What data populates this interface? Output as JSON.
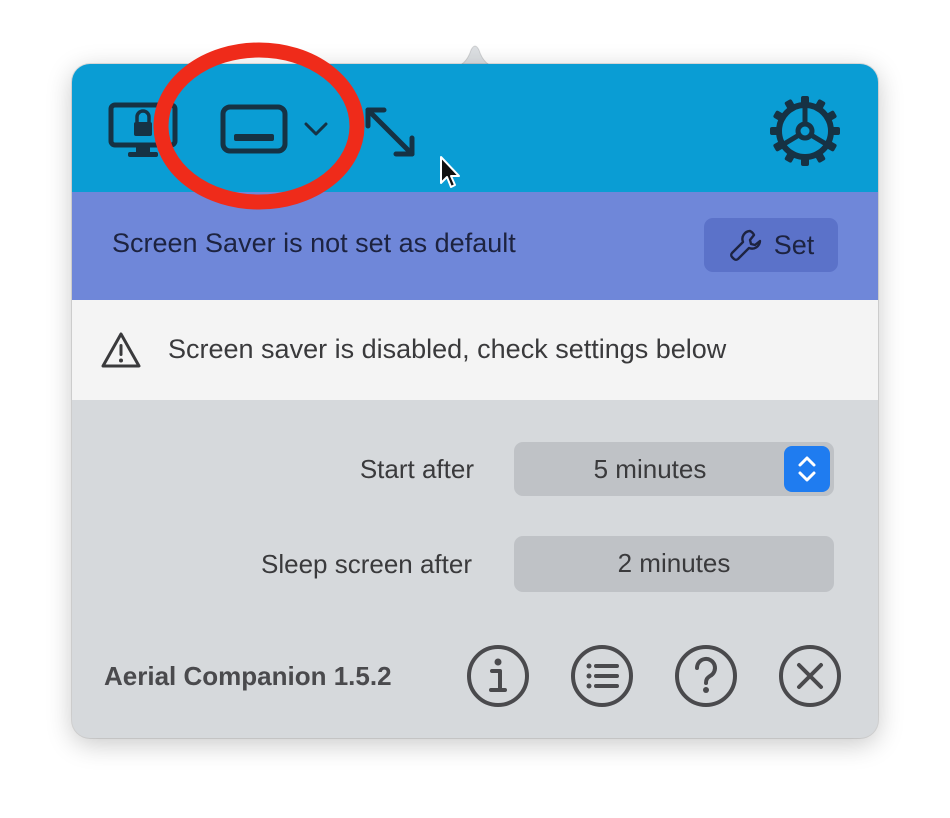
{
  "toolbar": {
    "lock_screen_icon": "monitor-lock-icon",
    "display_mode_icon": "display-window-icon",
    "display_mode_chevron": "chevron-down-icon",
    "expand_icon": "expand-diagonal-icon",
    "settings_icon": "gear-icon"
  },
  "banner": {
    "message": "Screen Saver is not set as default",
    "set_label": "Set",
    "set_icon": "wrench-icon"
  },
  "warning": {
    "icon": "warning-triangle-icon",
    "message": "Screen saver is disabled, check settings below"
  },
  "settings": {
    "start_after_label": "Start after",
    "start_after_value": "5 minutes",
    "sleep_after_label": "Sleep screen after",
    "sleep_after_value": "2 minutes"
  },
  "footer": {
    "version": "Aerial Companion 1.5.2",
    "buttons": [
      "info-icon",
      "list-icon",
      "help-icon",
      "close-icon"
    ]
  },
  "colors": {
    "toolbar_bg": "#0a9dd4",
    "banner_bg": "#6f87d9",
    "warning_bg": "#f4f4f4",
    "panel_bg": "#d6d9dc",
    "annotation": "#ef2b1a",
    "stepper": "#1f7cf0"
  }
}
